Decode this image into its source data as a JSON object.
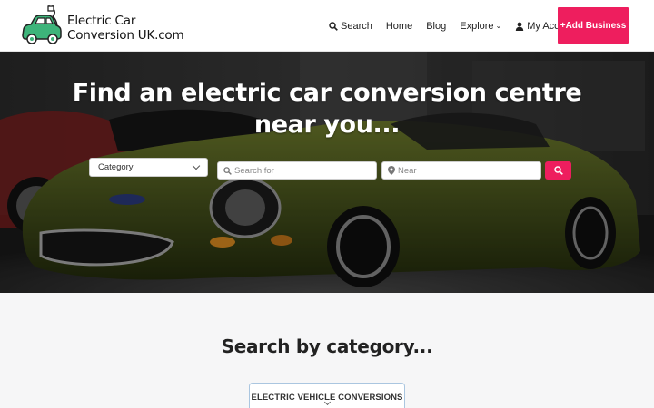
{
  "logo": {
    "line1": "Electric Car",
    "line2": "Conversion UK.com",
    "icon": "green-car-plug-icon"
  },
  "nav": {
    "search": "Search",
    "home": "Home",
    "blog": "Blog",
    "explore": "Explore",
    "account": "My Account",
    "add_business": "+Add Business"
  },
  "hero": {
    "title": "Find an electric car conversion centre near you...",
    "category_value": "Category",
    "search_placeholder": "Search for",
    "near_placeholder": "Near",
    "search_button_icon": "search-icon"
  },
  "categories": {
    "heading": "Search by category...",
    "items": [
      {
        "label": "ELECTRIC VEHICLE CONVERSIONS"
      }
    ]
  },
  "colors": {
    "accent": "#ee1e5e",
    "logo_car": "#3db47a",
    "card_border": "#aac6e0"
  }
}
